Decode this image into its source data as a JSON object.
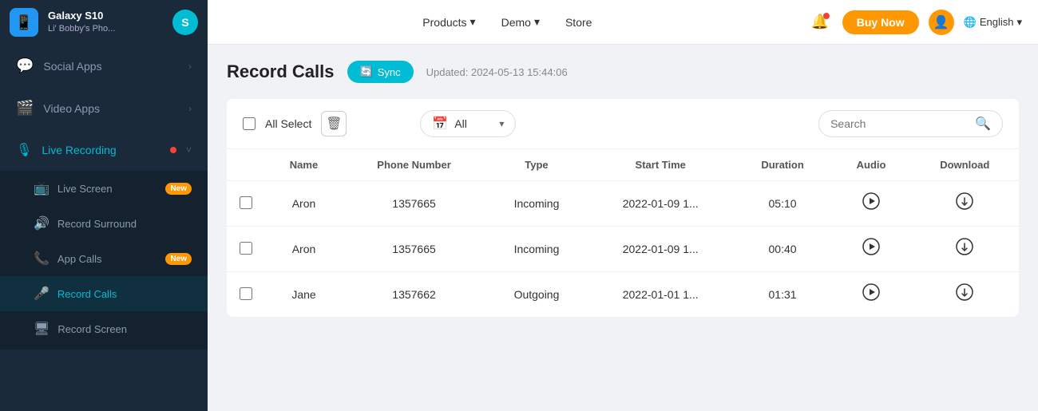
{
  "topnav": {
    "device_model": "Galaxy S10",
    "device_name": "Li' Bobby's Pho...",
    "device_icon": "📱",
    "sync_initial": "S",
    "nav_links": [
      {
        "label": "Products",
        "has_arrow": true
      },
      {
        "label": "Demo",
        "has_arrow": true
      },
      {
        "label": "Store",
        "has_arrow": false
      }
    ],
    "buy_label": "Buy Now",
    "language": "English"
  },
  "sidebar": {
    "sections": [
      {
        "id": "social-apps",
        "icon": "💬",
        "label": "Social Apps",
        "has_chevron": true,
        "active": false
      },
      {
        "id": "video-apps",
        "icon": "🎬",
        "label": "Video Apps",
        "has_chevron": true,
        "active": false
      },
      {
        "id": "live-recording",
        "icon": "🎙",
        "label": "Live Recording",
        "has_chevron": true,
        "active": true,
        "has_dot": true,
        "sub_items": [
          {
            "id": "live-screen",
            "icon": "📺",
            "label": "Live Screen",
            "badge": "New"
          },
          {
            "id": "record-surround",
            "icon": "🔊",
            "label": "Record Surround",
            "badge": null
          },
          {
            "id": "app-calls",
            "icon": "📞",
            "label": "App Calls",
            "badge": "New"
          },
          {
            "id": "record-calls",
            "icon": "🎤",
            "label": "Record Calls",
            "badge": null,
            "active": true
          },
          {
            "id": "record-screen",
            "icon": "🖥",
            "label": "Record Screen",
            "badge": null
          }
        ]
      }
    ]
  },
  "content": {
    "page_title": "Record Calls",
    "sync_label": "Sync",
    "updated_text": "Updated: 2024-05-13 15:44:06",
    "toolbar": {
      "all_select_label": "All Select",
      "delete_icon": "🗑",
      "filter_label": "All",
      "search_placeholder": "Search"
    },
    "table": {
      "columns": [
        "",
        "Name",
        "Phone Number",
        "Type",
        "Start Time",
        "Duration",
        "Audio",
        "Download"
      ],
      "rows": [
        {
          "name": "Aron",
          "phone": "1357665",
          "type": "Incoming",
          "start_time": "2022-01-09 1...",
          "duration": "05:10"
        },
        {
          "name": "Aron",
          "phone": "1357665",
          "type": "Incoming",
          "start_time": "2022-01-09 1...",
          "duration": "00:40"
        },
        {
          "name": "Jane",
          "phone": "1357662",
          "type": "Outgoing",
          "start_time": "2022-01-01 1...",
          "duration": "01:31"
        }
      ]
    }
  }
}
